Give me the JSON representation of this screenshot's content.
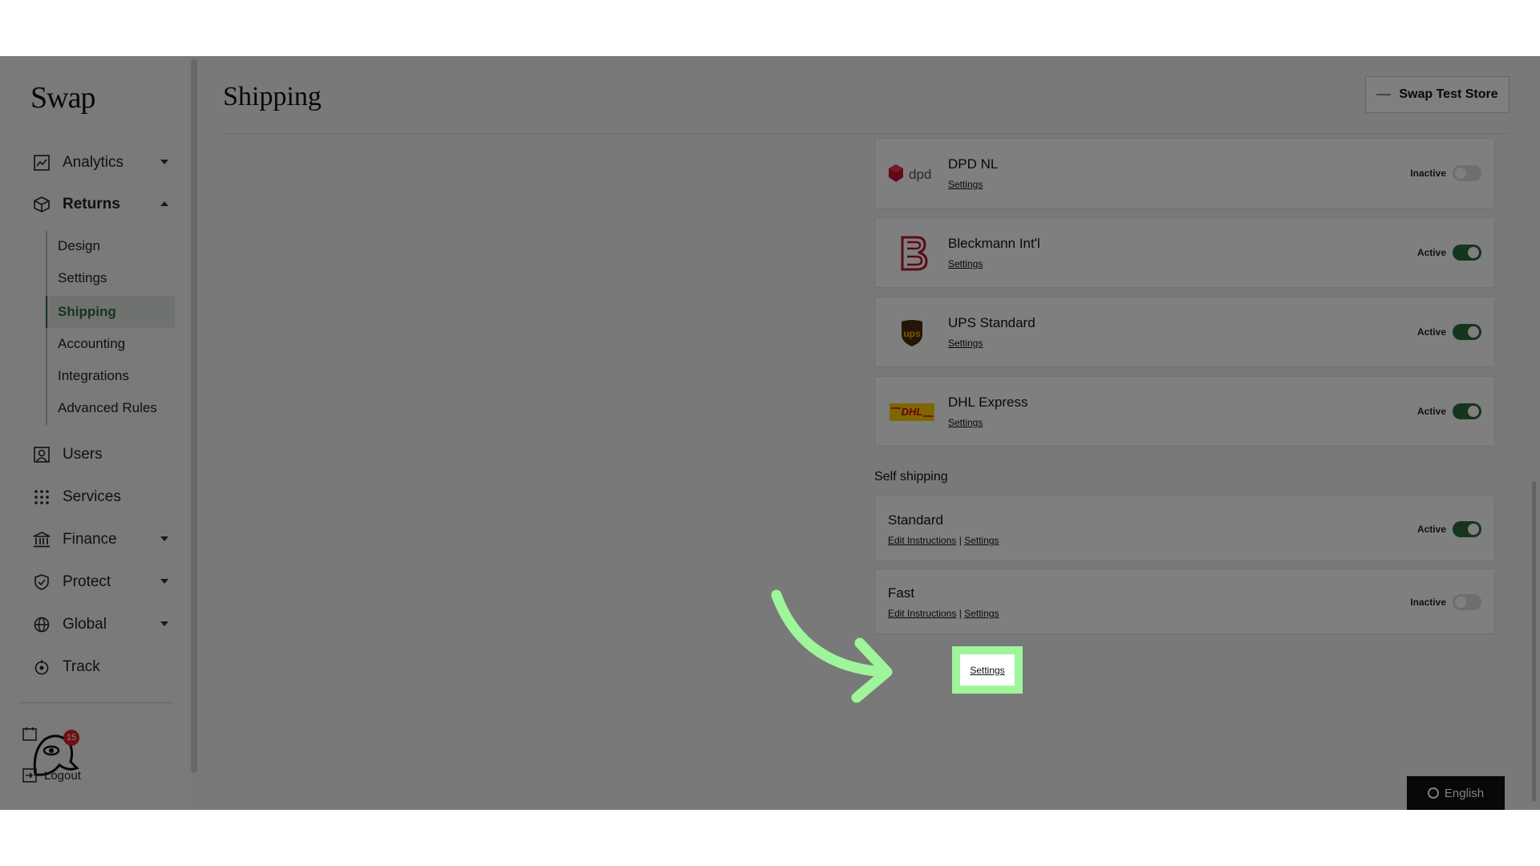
{
  "app": {
    "logo": "Swap"
  },
  "header": {
    "title": "Shipping",
    "store_name": "Swap Test Store"
  },
  "sidebar": {
    "items": [
      {
        "label": "Analytics",
        "icon": "chart-icon",
        "expandable": true
      },
      {
        "label": "Returns",
        "icon": "package-icon",
        "expandable": true,
        "expanded": true
      },
      {
        "label": "Users",
        "icon": "user-icon"
      },
      {
        "label": "Services",
        "icon": "grid-icon"
      },
      {
        "label": "Finance",
        "icon": "bank-icon",
        "expandable": true
      },
      {
        "label": "Protect",
        "icon": "shield-icon",
        "expandable": true
      },
      {
        "label": "Global",
        "icon": "globe-icon",
        "expandable": true
      },
      {
        "label": "Track",
        "icon": "track-icon"
      }
    ],
    "returns_sub": [
      "Design",
      "Settings",
      "Shipping",
      "Accounting",
      "Integrations",
      "Advanced Rules"
    ],
    "active_sub": "Shipping",
    "bottom": {
      "notifications_count": "15",
      "logout_label": "Logout"
    }
  },
  "carriers": [
    {
      "name": "DPD NL",
      "link": "Settings",
      "status": "Inactive",
      "logo": "dpd-logo"
    },
    {
      "name": "Bleckmann Int'l",
      "link": "Settings",
      "status": "Active",
      "logo": "bleckmann-logo"
    },
    {
      "name": "UPS Standard",
      "link": "Settings",
      "status": "Active",
      "logo": "ups-logo"
    },
    {
      "name": "DHL Express",
      "link": "Settings",
      "status": "Active",
      "logo": "dhl-logo"
    }
  ],
  "self_shipping": {
    "label": "Self shipping",
    "items": [
      {
        "name": "Standard",
        "link_instructions": "Edit Instructions",
        "separator": "|",
        "link_settings": "Settings",
        "status": "Active"
      },
      {
        "name": "Fast",
        "link_instructions": "Edit Instructions",
        "separator": "|",
        "link_settings": "Settings",
        "status": "Inactive"
      }
    ]
  },
  "highlight": {
    "label": "Settings"
  },
  "language": {
    "label": "English"
  },
  "colors": {
    "accent": "#2d6a3a",
    "highlight": "#9ef59a",
    "dim": "#000000"
  }
}
